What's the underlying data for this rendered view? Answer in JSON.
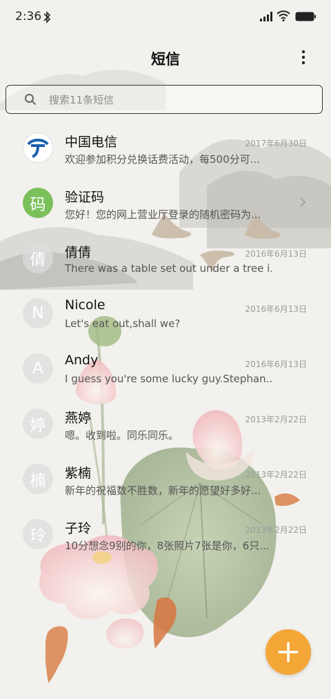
{
  "status_bar": {
    "time": "2:36",
    "icons": [
      "bluetooth-icon",
      "signal-icon",
      "wifi-icon",
      "battery-icon"
    ]
  },
  "header": {
    "title": "短信",
    "more_icon": "more-vertical-icon"
  },
  "search": {
    "placeholder": "搜索11条短信",
    "value": ""
  },
  "conversations": [
    {
      "name": "中国电信",
      "avatar": "china-telecom-logo",
      "date": "2017年6月30日",
      "snippet": "欢迎参加积分兑换话费活动，每500分可..."
    },
    {
      "name": "验证码",
      "avatar": "码",
      "date": "",
      "snippet": "您好！您的网上营业厅登录的随机密码为...",
      "has_chevron": true
    },
    {
      "name": "倩倩",
      "avatar": "倩",
      "date": "2016年6月13日",
      "snippet": "There was a table set out under a tree i..."
    },
    {
      "name": "Nicole",
      "avatar": "N",
      "date": "2016年6月13日",
      "snippet": "Let's eat out,shall we?"
    },
    {
      "name": "Andy",
      "avatar": "A",
      "date": "2016年6月13日",
      "snippet": "I guess you're some lucky guy.Stephan..."
    },
    {
      "name": "燕婷",
      "avatar": "婷",
      "date": "2013年2月22日",
      "snippet": "嗯。收到啦。同乐同乐。"
    },
    {
      "name": "紫楠",
      "avatar": "楠",
      "date": "2013年2月22日",
      "snippet": "新年的祝福数不胜数，新年的愿望好多好..."
    },
    {
      "name": "子玲",
      "avatar": "玲",
      "date": "2013年2月22日",
      "snippet": "10分想念9别的你，8张照片7张是你，6只..."
    }
  ],
  "fab": {
    "icon": "plus-icon"
  },
  "colors": {
    "accent": "#f4a637",
    "verify_avatar": "#7cc05c",
    "telecom_blue": "#1a5fad"
  },
  "background_theme": "ink-painting-lotus-mountains"
}
